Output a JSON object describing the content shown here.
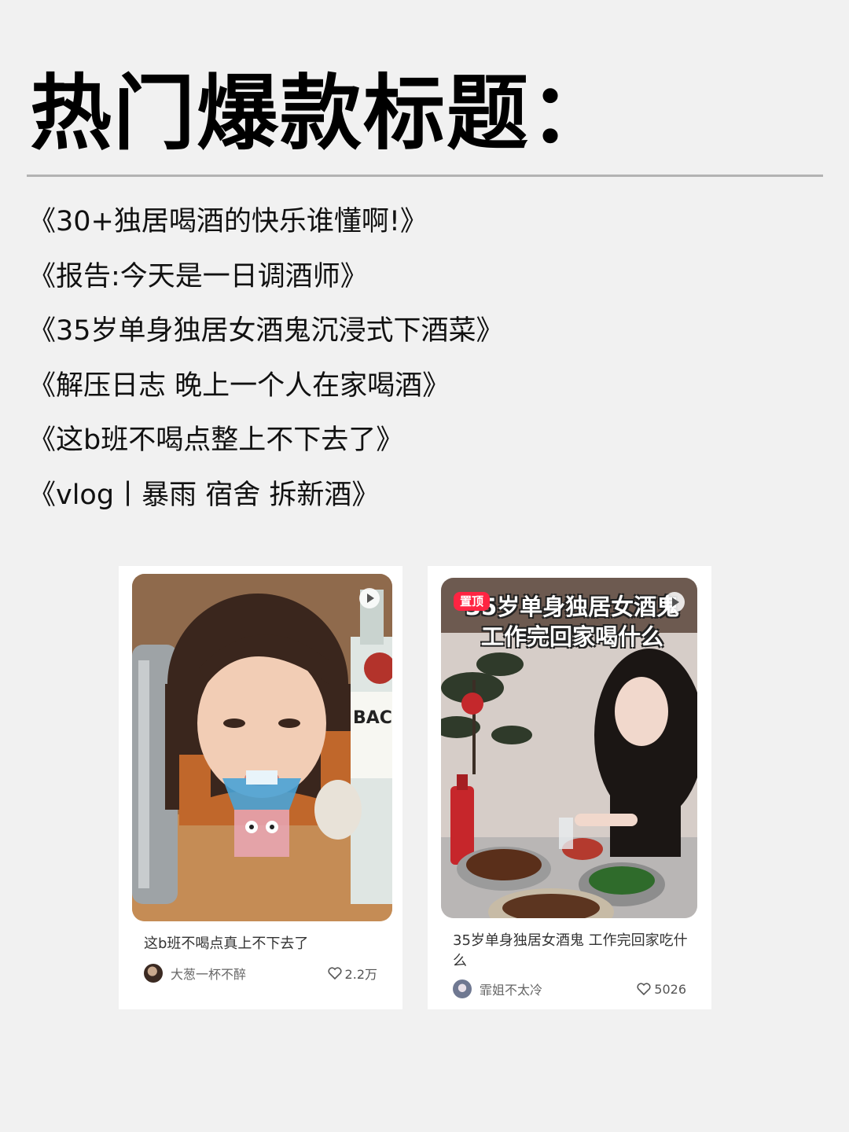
{
  "page": {
    "title": "热门爆款标题："
  },
  "titles": [
    "《30+独居喝酒的快乐谁懂啊!》",
    "《报告:今天是一日调酒师》",
    "《35岁单身独居女酒鬼沉浸式下酒菜》",
    "《解压日志 晚上一个人在家喝酒》",
    "《这b班不喝点整上不下去了》",
    "《vlog丨暴雨 宿舍 拆新酒》"
  ],
  "cards": [
    {
      "title": "这b班不喝点真上不下去了",
      "author": "大葱一杯不醉",
      "likes": "2.2万",
      "thumbnail_icon": "play-icon",
      "bottle_label": "BACA"
    },
    {
      "title": "35岁单身独居女酒鬼 工作完回家吃什么",
      "author": "霏姐不太冷",
      "likes": "5026",
      "badge": "置顶",
      "overlay_text": "35岁单身独居女酒鬼 工作完回家喝什么",
      "thumbnail_icon": "play-icon"
    }
  ],
  "colors": {
    "background": "#f1f1f1",
    "card": "#ffffff",
    "badge": "#ff2442",
    "divider": "#b3b3b3"
  }
}
